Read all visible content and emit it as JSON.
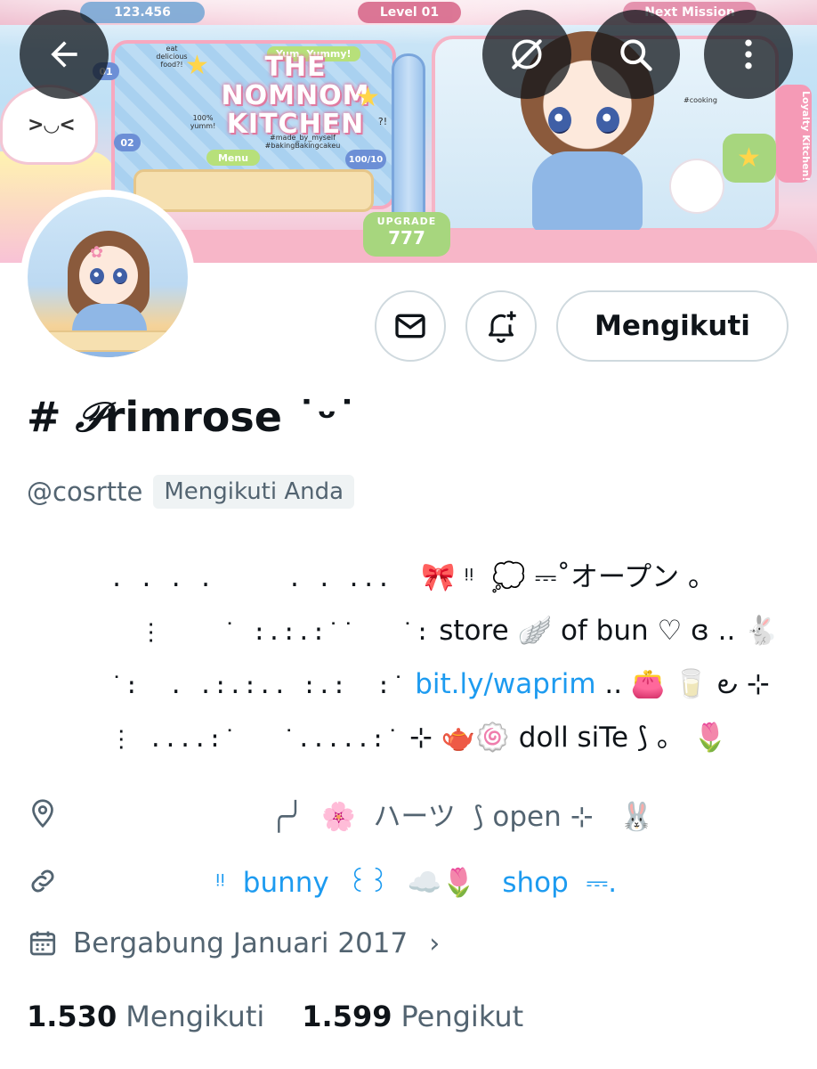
{
  "banner": {
    "score": "123.456",
    "level": "Level 01",
    "mission": "Next Mission",
    "title": "THE NOMNOM KITCHEN",
    "yum": "Yum, Yummy!",
    "eat_note": "eat delicious food?!",
    "percent_note": "100% yumm!",
    "hashtags": "#made_by_myself #bakingBakingcakeu",
    "menu": "Menu",
    "counter": "100/10",
    "badge_01": "01",
    "badge_02": "02",
    "upgrade_label": "UPGRADE",
    "upgrade_value": "777",
    "cooking_note": "#cooking",
    "loyal": "Loyalty Kitchen!",
    "question": "?!"
  },
  "nav": {
    "back_icon": "back-arrow-icon",
    "grok_icon": "grok-icon",
    "search_icon": "search-icon",
    "more_icon": "more-vertical-icon"
  },
  "actions": {
    "message_icon": "envelope-icon",
    "notify_icon": "bell-plus-icon",
    "following_label": "Mengikuti"
  },
  "profile": {
    "name_prefix": "# ",
    "name_script": "𝒫",
    "name_rest": "rimrose ˙ᵕ˙",
    "handle": "@cosrtte",
    "follows_you": "Mengikuti Anda"
  },
  "bio": {
    "line1_dots": "  . . . .     . . ...  ",
    "line1_text": "🎀 ᵎᵎ  💭 ⎓˚オープン 。",
    "line2_dots": "    ⋮    ˙ :.:.:˙˙   ˙:",
    "line2_text": " store 🪽 of bun ♡ ɞ .. 🐇",
    "line3_dots": "  ˙:  . .:.:.. :.:  :˙",
    "line3_link": " bit.ly/waprim",
    "line3_text": " .. 👛 🥛 ౿ ⊹",
    "line4_dots": "  ⋮ ....:˙   ˙.....:˙",
    "line4_text": " ⊹ 🫖🍥 doll siTe ⟆ 。 🌷"
  },
  "location": {
    "icon": "location-pin-icon",
    "text": "╭╯  🌸  ハーツ  ⟆ open ⊹   🐰"
  },
  "website": {
    "icon": "link-icon",
    "text": "ᵎᵎ  bunny  ꒰꒱  ☁️🌷   shop  ⎓."
  },
  "joined": {
    "icon": "calendar-icon",
    "text": "Bergabung Januari 2017",
    "chevron": "›"
  },
  "stats": {
    "following_count": "1.530",
    "following_label": "Mengikuti",
    "followers_count": "1.599",
    "followers_label": "Pengikut"
  }
}
